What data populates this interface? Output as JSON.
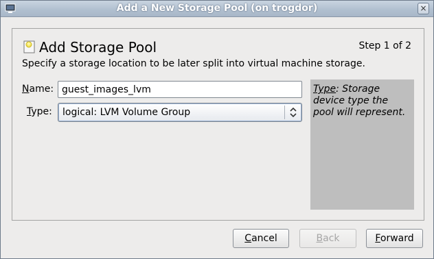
{
  "window": {
    "title": "Add a New Storage Pool (on trogdor)",
    "close_glyph": "×"
  },
  "header": {
    "heading": "Add Storage Pool",
    "step": "Step 1 of 2",
    "subtitle": "Specify a storage location to be later split into virtual machine storage."
  },
  "form": {
    "name_label_mnemonic": "N",
    "name_label_rest": "ame:",
    "name_value": "guest_images_lvm",
    "type_label_mnemonic": "T",
    "type_label_rest": "ype:",
    "type_value": "logical: LVM Volume Group"
  },
  "help": {
    "term": "Type",
    "text": ": Storage device type the pool will represent."
  },
  "buttons": {
    "cancel_mnemonic": "C",
    "cancel_rest": "ancel",
    "back_mnemonic": "B",
    "back_rest": "ack",
    "forward_mnemonic": "F",
    "forward_rest": "orward"
  },
  "colors": {
    "help_background": "#bebebe",
    "window_background": "#edeceb"
  }
}
